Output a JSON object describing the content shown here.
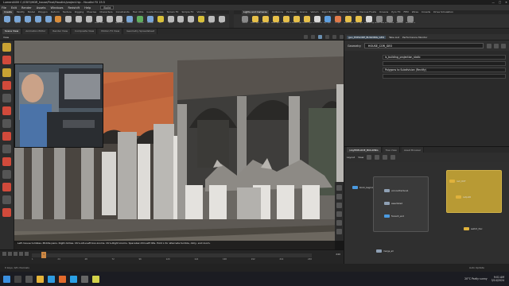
{
  "window": {
    "title": "Lumen4400 C:/CSE3/HDR_house/Final/Houdini/project.hip - Houdini FX 19.5"
  },
  "menu": {
    "items": [
      "File",
      "Edit",
      "Render",
      "Assets",
      "Windows",
      "Redshift",
      "Help"
    ],
    "desktop": "Build"
  },
  "shelf_tabs_left": [
    "Create",
    "Modify",
    "Model",
    "Polygon",
    "Deform",
    "Texture",
    "Rigging",
    "Muscles",
    "Characters",
    "Constraints",
    "Hair Utils",
    "Guide Process",
    "Terrain FX",
    "Simple FX",
    "Volume"
  ],
  "shelf_tabs_right": [
    "Lights and Cameras",
    "Collisions",
    "Particles",
    "Grains",
    "Vellum",
    "Rigid Bodies",
    "Particle Fluids",
    "Viscous Fluids",
    "Oceans",
    "Pyro FX",
    "FEM",
    "Wires",
    "Crowds",
    "Drive Simulation"
  ],
  "shelf_tools_left": [
    {
      "label": "Box",
      "color": "#7aa6d6"
    },
    {
      "label": "Sphere",
      "color": "#7aa6d6"
    },
    {
      "label": "Tube",
      "color": "#7aa6d6"
    },
    {
      "label": "Torus",
      "color": "#7aa6d6"
    },
    {
      "label": "Grid",
      "color": "#7aa6d6"
    },
    {
      "label": "Null",
      "color": "#d98d3b"
    },
    {
      "label": "Line",
      "color": "#bbbbbb"
    },
    {
      "label": "Circle",
      "color": "#bbbbbb"
    },
    {
      "label": "Curve",
      "color": "#bbbbbb"
    },
    {
      "label": "Draw Curve",
      "color": "#bbbbbb"
    },
    {
      "label": "Path",
      "color": "#bbbbbb"
    },
    {
      "label": "Spray Paint",
      "color": "#bbbbbb"
    },
    {
      "label": "Platonic",
      "color": "#7aa6d6"
    },
    {
      "label": "L-System",
      "color": "#5fae5f"
    },
    {
      "label": "Metaball",
      "color": "#7aa6d6"
    },
    {
      "label": "File",
      "color": "#d9c13b"
    },
    {
      "label": "Spiral",
      "color": "#bbbbbb"
    },
    {
      "label": "Helix",
      "color": "#bbbbbb"
    },
    {
      "label": "Font",
      "color": "#bbbbbb"
    },
    {
      "label": "Geo",
      "color": "#d9c13b"
    },
    {
      "label": "Sprite",
      "color": "#bbbbbb"
    },
    {
      "label": "Ark",
      "color": "#bbbbbb"
    }
  ],
  "shelf_tools_right": [
    {
      "label": "Camera",
      "color": "#8a8a8a"
    },
    {
      "label": "Point Light",
      "color": "#e6c04a"
    },
    {
      "label": "Spot Light",
      "color": "#e6c04a"
    },
    {
      "label": "Area Light",
      "color": "#e6c04a"
    },
    {
      "label": "Geometry Light",
      "color": "#e6c04a"
    },
    {
      "label": "Volume Light",
      "color": "#e6c04a"
    },
    {
      "label": "Distant Light",
      "color": "#e6c04a"
    },
    {
      "label": "Environment Light",
      "color": "#d8d8d8"
    },
    {
      "label": "Sky Light",
      "color": "#5e9fe0"
    },
    {
      "label": "GI Light",
      "color": "#e07a4a"
    },
    {
      "label": "Caustic Light",
      "color": "#e6c04a"
    },
    {
      "label": "Portal Light",
      "color": "#e6c04a"
    },
    {
      "label": "Ambient Light",
      "color": "#d8d8d8"
    },
    {
      "label": "Stereo Camera",
      "color": "#8a8a8a"
    },
    {
      "label": "VR Camera",
      "color": "#8a8a8a"
    },
    {
      "label": "Switcher",
      "color": "#8a8a8a"
    },
    {
      "label": "Gamepad Camera",
      "color": "#8a8a8a"
    }
  ],
  "panel_tabs": [
    "Scene View",
    "Animation Editor",
    "Render View",
    "Composite View",
    "Motion FX View",
    "Geometry Spreadsheet"
  ],
  "viewport": {
    "label": "View",
    "status_text": "Left mouse tumbles. Middle pans. Right dollies. Ctrl+Alt+Left box-zooms. Ctrl+Right zooms. Spacebar-Ctrl-Left tilts. Hold L for alternate tumble, dolly, and zoom."
  },
  "params": {
    "tabs": [
      "geo_EXPLODE_BUILDING_GEO",
      "Take List",
      "Performance Monitor"
    ],
    "node_type": "Geometry",
    "node_name": "HOUSE_COR_GEO",
    "rows": [
      {
        "label": "",
        "value": "ls_building_projection_static"
      },
      {
        "label": "",
        "value": ""
      },
      {
        "label": "",
        "value": "Polygons to Subdivision (Rectify)"
      },
      {
        "label": "",
        "value": ""
      }
    ]
  },
  "network": {
    "tabs": [
      "/obj/EXPLODE_BUILDING",
      "Tree View",
      "Asset Browser"
    ],
    "layout_label": "Layout",
    "view_label": "View",
    "nodes": [
      {
        "label": "block_begin1",
        "kind": "b"
      },
      {
        "label": "voronoifracture1",
        "kind": "g"
      },
      {
        "label": "assemble2",
        "kind": "g"
      },
      {
        "label": "foreach_end",
        "kind": "b"
      },
      {
        "label": "null_OUT",
        "kind": "y"
      },
      {
        "label": "output0",
        "kind": "y"
      },
      {
        "label": "switch_frac",
        "kind": "y"
      },
      {
        "label": "merge_all",
        "kind": "g"
      }
    ]
  },
  "timeline": {
    "current_frame": "1",
    "ticks": [
      "1",
      "24",
      "48",
      "72",
      "96",
      "120",
      "144",
      "168",
      "192",
      "216",
      "240"
    ],
    "end_frame": "240",
    "keys_label": "0 keys, 0/0 channels",
    "auto_update": "Auto Update"
  },
  "taskbar": {
    "weather": "20°C Partly sunny",
    "time": "9:01 AM",
    "date": "3/14/2024",
    "icons": [
      {
        "name": "start",
        "color": "#3a8fe0"
      },
      {
        "name": "search",
        "color": "#444"
      },
      {
        "name": "task-view",
        "color": "#555"
      },
      {
        "name": "file-explorer",
        "color": "#e6b43a"
      },
      {
        "name": "browser",
        "color": "#2f9be0"
      },
      {
        "name": "houdini",
        "color": "#e36a2c"
      },
      {
        "name": "photoshop",
        "color": "#2aa0e6"
      },
      {
        "name": "obs",
        "color": "#666"
      },
      {
        "name": "notes",
        "color": "#d2d24a"
      }
    ]
  }
}
